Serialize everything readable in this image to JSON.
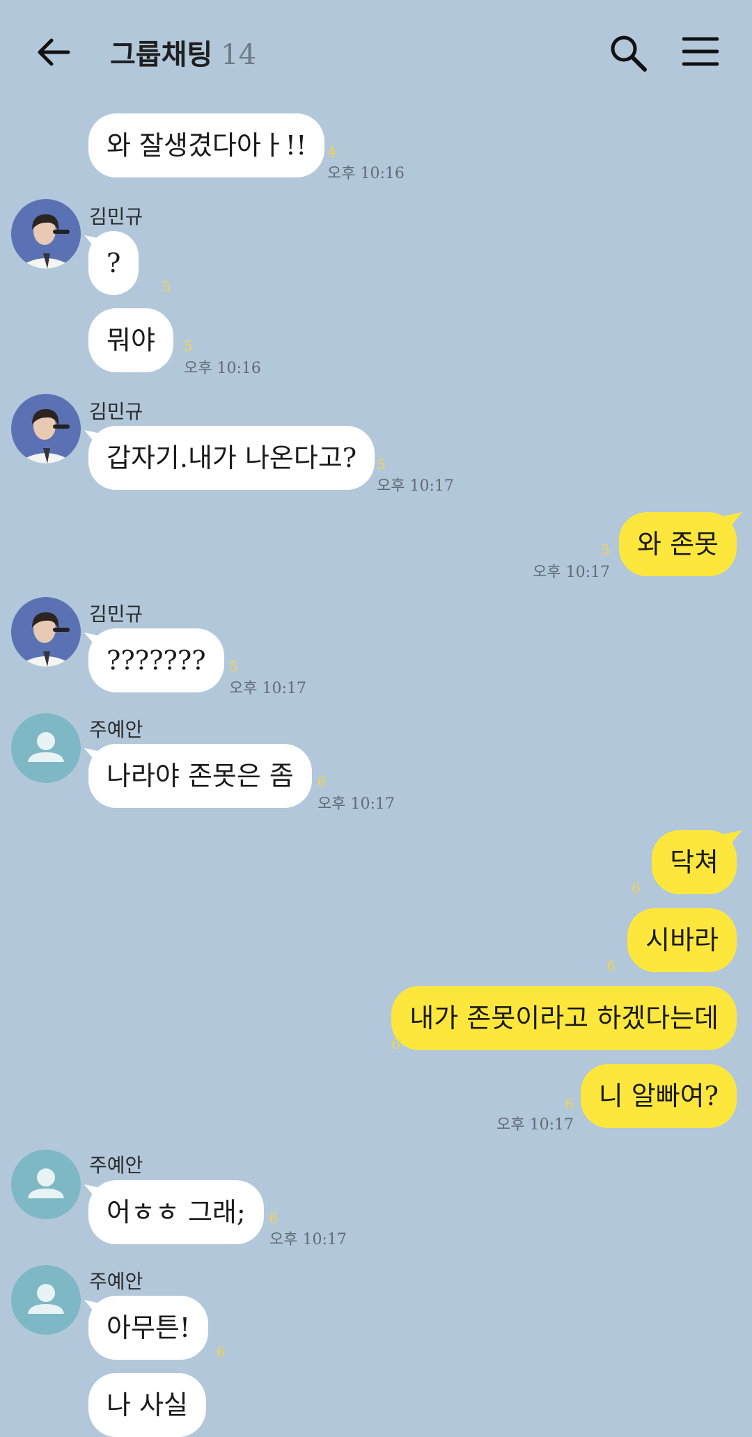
{
  "header": {
    "title": "그룹채팅",
    "count": "14"
  },
  "colors": {
    "background": "#b2c7da",
    "incoming_bubble": "#ffffff",
    "outgoing_bubble": "#fee73d",
    "unread_count": "#f3d54c"
  },
  "icons": {
    "back": "arrow-left",
    "search": "magnifier",
    "menu": "hamburger",
    "avatar_default": "person-silhouette"
  },
  "messages": [
    {
      "text": "와 잘생겼다아ㅏ!!",
      "unread": "4",
      "time": "오후 10:16"
    },
    {
      "sender": "김민규",
      "text": "?",
      "unread": "5"
    },
    {
      "text": "뭐야",
      "unread": "5",
      "time": "오후 10:16"
    },
    {
      "sender": "김민규",
      "text": "갑자기.내가 나온다고?",
      "unread": "5",
      "time": "오후 10:17"
    },
    {
      "text": "와 존못",
      "unread": "5",
      "time": "오후 10:17"
    },
    {
      "sender": "김민규",
      "text": "???????",
      "unread": "5",
      "time": "오후 10:17"
    },
    {
      "sender": "주예안",
      "text": "나라야 존못은 좀",
      "unread": "6",
      "time": "오후 10:17"
    },
    {
      "text": "닥쳐",
      "unread": "6"
    },
    {
      "text": "시바라",
      "unread": "6"
    },
    {
      "text": "내가 존못이라고 하겠다는데",
      "unread": "6"
    },
    {
      "text": "니 알빠여?",
      "unread": "6",
      "time": "오후 10:17"
    },
    {
      "sender": "주예안",
      "text": "어ㅎㅎ 그래;",
      "unread": "6",
      "time": "오후 10:17"
    },
    {
      "sender": "주예안",
      "text": "아무튼!",
      "unread": "6"
    },
    {
      "text": "나 사실"
    }
  ]
}
